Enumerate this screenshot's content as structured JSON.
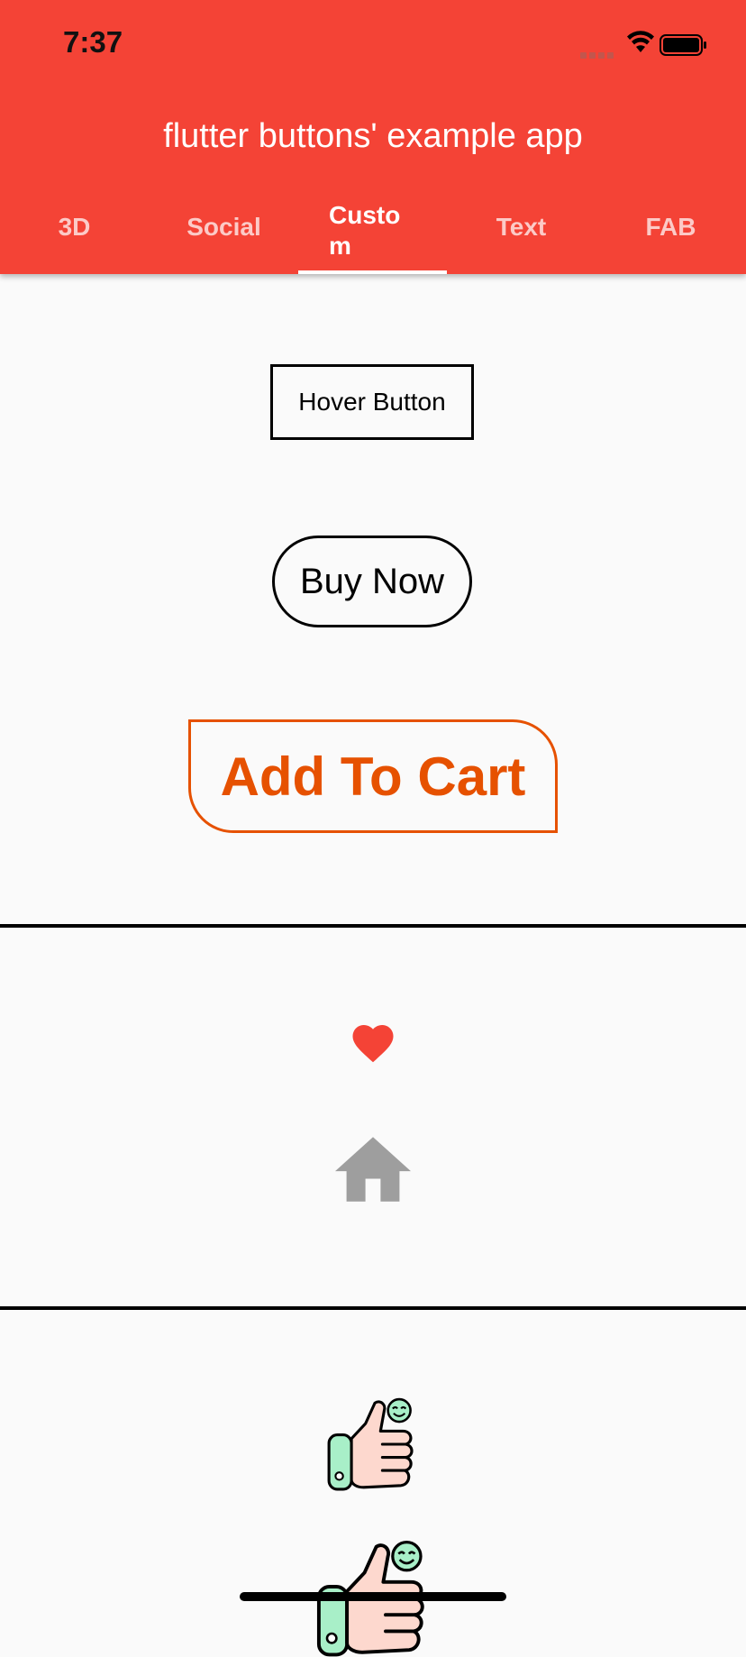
{
  "status_bar": {
    "time": "7:37"
  },
  "app_bar": {
    "title": "flutter buttons' example app"
  },
  "tabs": [
    {
      "label": "3D"
    },
    {
      "label": "Social"
    },
    {
      "label": "Custom"
    },
    {
      "label": "Text"
    },
    {
      "label": "FAB"
    }
  ],
  "selected_tab": "Custom",
  "buttons": {
    "hover_label": "Hover Button",
    "buy_now_label": "Buy Now",
    "add_to_cart_label": "Add To Cart"
  },
  "icons": {
    "like": "heart-icon",
    "home": "home-icon",
    "thumbs": "thumbs-up-icon"
  },
  "colors": {
    "app_bar": "#f44336",
    "add_to_cart": "#e65100",
    "heart": "#f44336",
    "home": "#9e9e9e",
    "background": "#fafafa"
  }
}
